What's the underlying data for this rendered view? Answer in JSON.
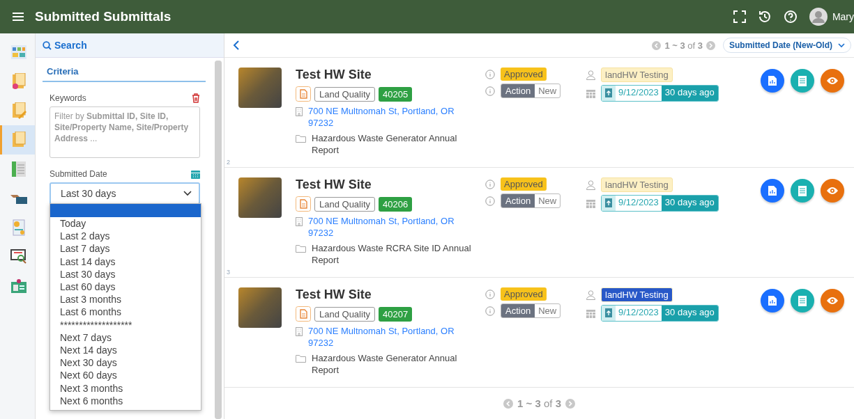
{
  "header": {
    "title": "Submitted Submittals",
    "user_name": "Mary"
  },
  "rail": {
    "items": [
      {
        "kind": "dashboard",
        "selected": false
      },
      {
        "kind": "doc-new",
        "selected": false
      },
      {
        "kind": "doc-edit",
        "selected": false
      },
      {
        "kind": "doc",
        "selected": true
      },
      {
        "kind": "ledger",
        "selected": false
      },
      {
        "kind": "handshake",
        "selected": false
      },
      {
        "kind": "certificate",
        "selected": false
      },
      {
        "kind": "monitor-search",
        "selected": false
      },
      {
        "kind": "id-badge",
        "selected": false
      }
    ]
  },
  "filter_panel": {
    "search_tab": "Search",
    "criteria_tab": "Criteria",
    "keywords": {
      "label": "Keywords",
      "placeholder": "Filter by **Submittal ID, Site ID, Site/Property Name, Site/Property Address** ..."
    },
    "submitted_date": {
      "label": "Submitted Date",
      "value": "Last 30 days",
      "dropdown": {
        "blank_option_highlighted": true,
        "options": [
          "Today",
          "Last 2 days",
          "Last 7 days",
          "Last 14 days",
          "Last 30 days",
          "Last 60 days",
          "Last 3 months",
          "Last 6 months",
          "*******************",
          "Next 7 days",
          "Next 14 days",
          "Next 30 days",
          "Next 60 days",
          "Next 3 months",
          "Next 6 months"
        ]
      }
    }
  },
  "toolbar": {
    "pagination": "**1 ~ 3** of **3**",
    "sort": "Submitted Date (New-Old)"
  },
  "cards": [
    {
      "title": "Test HW Site",
      "program": "Land Quality",
      "id": "40205",
      "address": "700 NE Multnomah St, Portland, OR 97232",
      "report": "Hazardous Waste Generator Annual Report",
      "status": "Approved",
      "action": "Action",
      "action_state": "New",
      "assignee": "landHW Testing",
      "assignee_highlighted": false,
      "date": "9/12/2023",
      "age": "30 days ago",
      "row_number": "2"
    },
    {
      "title": "Test HW Site",
      "program": "Land Quality",
      "id": "40206",
      "address": "700 NE Multnomah St, Portland, OR 97232",
      "report": "Hazardous Waste RCRA Site ID Annual Report",
      "status": "Approved",
      "action": "Action",
      "action_state": "New",
      "assignee": "landHW Testing",
      "assignee_highlighted": false,
      "date": "9/12/2023",
      "age": "30 days ago",
      "row_number": "3"
    },
    {
      "title": "Test HW Site",
      "program": "Land Quality",
      "id": "40207",
      "address": "700 NE Multnomah St, Portland, OR 97232",
      "report": "Hazardous Waste Generator Annual Report",
      "status": "Approved",
      "action": "Action",
      "action_state": "New",
      "assignee": "landHW Testing",
      "assignee_highlighted": true,
      "date": "9/12/2023",
      "age": "30 days ago"
    }
  ],
  "footer": {
    "pagination": "**1 ~ 3** of **3**"
  }
}
